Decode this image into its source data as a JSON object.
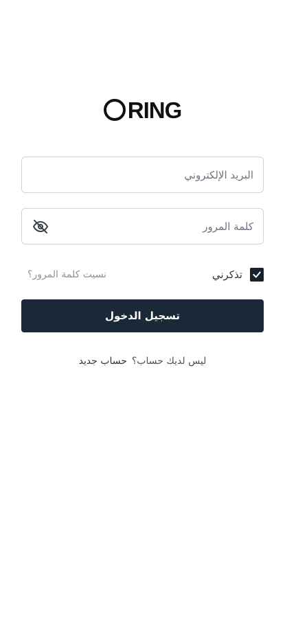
{
  "logo": {
    "text": "RING"
  },
  "form": {
    "email_placeholder": "البريد الإلكتروني",
    "password_placeholder": "كلمة المرور",
    "remember_label": "تذكرني",
    "remember_checked": true,
    "forgot_link": "نسيت كلمة المرور؟",
    "login_button": "تسجيل الدخول"
  },
  "signup": {
    "prompt": "ليس لديك حساب؟",
    "link": "حساب جديد"
  },
  "colors": {
    "primary": "#1b2837",
    "border": "#cfd3d7"
  },
  "icons": {
    "password_toggle": "eye-off-icon",
    "checkbox": "check-icon"
  }
}
